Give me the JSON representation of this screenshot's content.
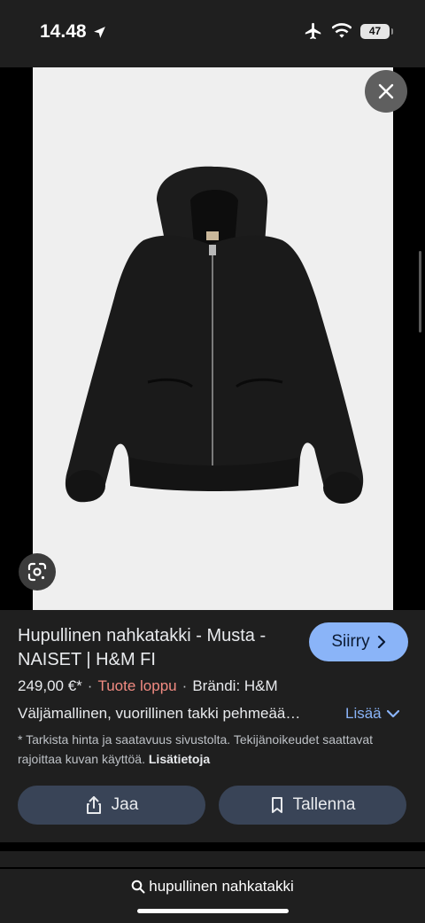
{
  "status_bar": {
    "time": "14.48",
    "battery": "47"
  },
  "viewer": {
    "close_icon": "close-icon",
    "lens_icon": "google-lens-icon",
    "image_subject": "black leather hooded jacket"
  },
  "product": {
    "title": "Hupullinen nahkatakki - Musta - NAISET | H&M FI",
    "go_label": "Siirry",
    "price": "249,00 €*",
    "stock": "Tuote loppu",
    "brand": "Brändi: H&M",
    "description": "Väljämallinen, vuorillinen takki pehmeää…",
    "more_label": "Lisää",
    "disclaimer": "* Tarkista hinta ja saatavuus sivustolta. Tekijänoikeudet saattavat rajoittaa kuvan käyttöä.",
    "more_info_label": "Lisätietoja",
    "share_label": "Jaa",
    "save_label": "Tallenna"
  },
  "search": {
    "query": "hupullinen nahkatakki"
  },
  "colors": {
    "accent": "#8ab4f8",
    "out_of_stock": "#f28b82",
    "panel": "#1f1f1f",
    "action_button": "#394457"
  }
}
